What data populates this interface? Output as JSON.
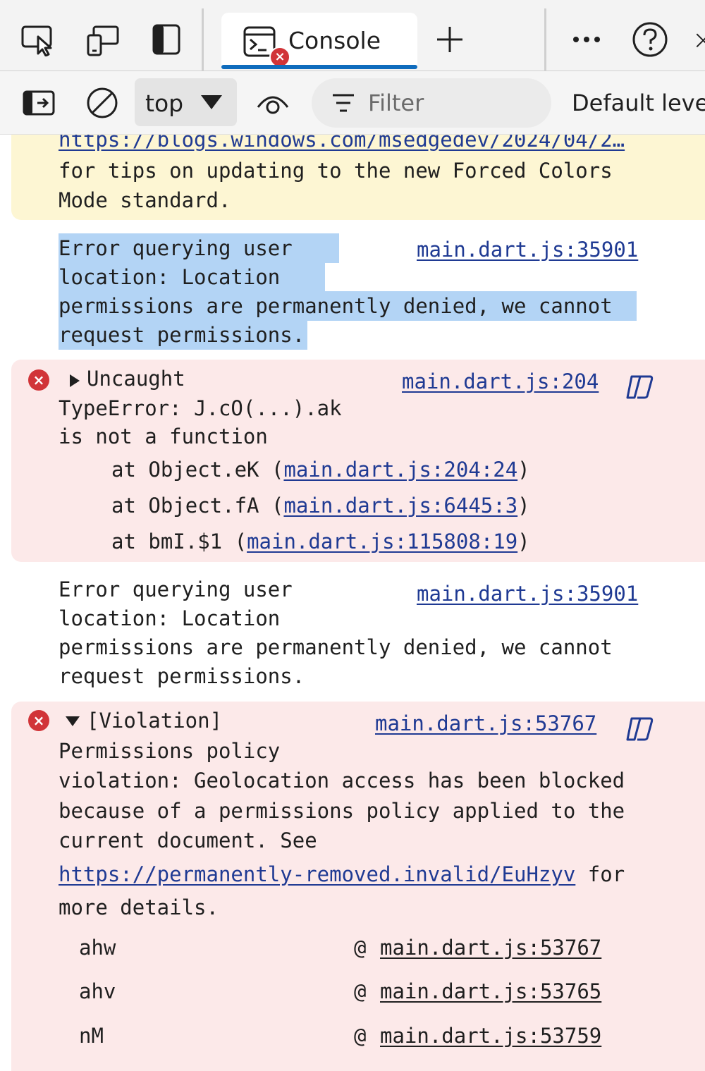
{
  "tabbar": {
    "console_tab_label": "Console"
  },
  "toolbar": {
    "context_value": "top",
    "filter_placeholder": "Filter",
    "levels_label": "Default levels"
  },
  "messages": {
    "warning": {
      "link": "https://blogs.windows.com/msedgedev/2024/04/2…",
      "line1": "for tips on updating to the new Forced Colors",
      "line2": "Mode standard."
    },
    "info1": {
      "source": "main.dart.js:35901",
      "line1": "Error querying user",
      "line2": "location: Location",
      "line3": "permissions are permanently denied, we cannot",
      "line4": "request permissions."
    },
    "error1": {
      "source": "main.dart.js:204",
      "line1": "Uncaught",
      "line2": "TypeError: J.cO(...).ak",
      "line3": "is not a function",
      "stack": [
        {
          "prefix": "at Object.eK (",
          "link": "main.dart.js:204:24",
          "suffix": ")"
        },
        {
          "prefix": "at Object.fA (",
          "link": "main.dart.js:6445:3",
          "suffix": ")"
        },
        {
          "prefix": "at bmI.$1 (",
          "link": "main.dart.js:115808:19",
          "suffix": ")"
        }
      ]
    },
    "info2": {
      "source": "main.dart.js:35901",
      "line1": "Error querying user",
      "line2": "location: Location",
      "line3": "permissions are permanently denied, we cannot",
      "line4": "request permissions."
    },
    "error2": {
      "source": "main.dart.js:53767",
      "line1": "[Violation]",
      "line2": "Permissions policy",
      "line3": "violation: Geolocation access has been blocked",
      "line4": "because of a permissions policy applied to the",
      "line5": "current document. See",
      "link": "https://permanently-removed.invalid/EuHzyv",
      "link_suffix": " for",
      "line7": "more details.",
      "frames": [
        {
          "name": "ahw",
          "at": "@",
          "link": "main.dart.js:53767"
        },
        {
          "name": "ahv",
          "at": "@",
          "link": "main.dart.js:53765"
        },
        {
          "name": "nM",
          "at": "@",
          "link": "main.dart.js:53759"
        }
      ]
    }
  }
}
